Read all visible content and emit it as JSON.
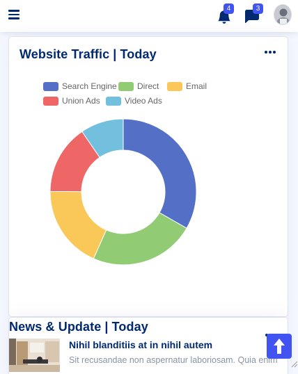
{
  "header": {
    "menu_icon": "list-icon",
    "notifications": {
      "icon": "bell-icon",
      "count": "4"
    },
    "messages": {
      "icon": "chat-icon",
      "count": "3"
    },
    "avatar_icon": "profile-avatar"
  },
  "traffic": {
    "title": "Website Traffic | Today",
    "more_icon": "three-dots-icon"
  },
  "chart_data": {
    "type": "pie",
    "donut": true,
    "title": "",
    "legend_position": "top-left",
    "categories": [
      "Search Engine",
      "Direct",
      "Email",
      "Union Ads",
      "Video Ads"
    ],
    "values": [
      1048,
      735,
      580,
      484,
      300
    ],
    "colors": [
      "#5470c6",
      "#91cc75",
      "#fac858",
      "#ee6666",
      "#73c0de"
    ]
  },
  "news": {
    "title": "News & Update | Today",
    "more_icon": "three-dots-icon",
    "item": {
      "headline": "Nihil blanditiis at in nihil autem",
      "excerpt": "Sit recusandae non aspernatur laboriosam. Quia enim"
    }
  },
  "back_to_top_icon": "arrow-up-icon"
}
